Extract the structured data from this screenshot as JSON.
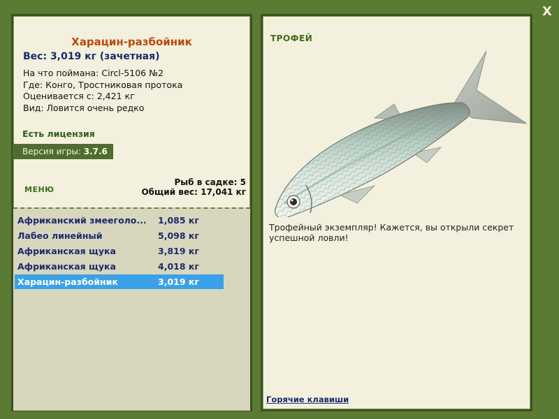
{
  "window": {
    "close_label": "X"
  },
  "fish": {
    "title": "Харацин-разбойник",
    "weight": "Вес: 3,019 кг (зачетная)",
    "caught_on": "На что поймана: Circl-5106 №2",
    "location": "Где: Конго, Тростниковая протока",
    "valued_from": "Оценивается с: 2,421 кг",
    "rarity": "Вид: Ловится очень редко"
  },
  "license": "Есть лицензия",
  "version": {
    "label": "Версия игры:",
    "value": "3.7.6"
  },
  "menu_label": "МЕНЮ",
  "cage": {
    "count": "Рыб в садке: 5",
    "total": "Общий вес: 17,041 кг"
  },
  "catch_list": [
    {
      "name": "Африканский змееголо...",
      "weight": "1,085 кг"
    },
    {
      "name": "Лабео линейный",
      "weight": "5,098 кг"
    },
    {
      "name": "Африканская щука",
      "weight": "3,819 кг"
    },
    {
      "name": "Африканская щука",
      "weight": "4,018 кг"
    },
    {
      "name": "Харацин-разбойник",
      "weight": "3,019 кг"
    }
  ],
  "selected_index": 4,
  "trophy": {
    "label": "ТРОФЕЙ",
    "message": "Трофейный экземпляр! Кажется, вы открыли секрет успешной ловли!"
  },
  "hotkeys_label": "Горячие клавиши",
  "colors": {
    "background": "#5b7a34",
    "panel": "#f3f1dd",
    "title": "#b8490d",
    "accent_blue": "#1a2b6e",
    "selection": "#3aa1e8"
  }
}
